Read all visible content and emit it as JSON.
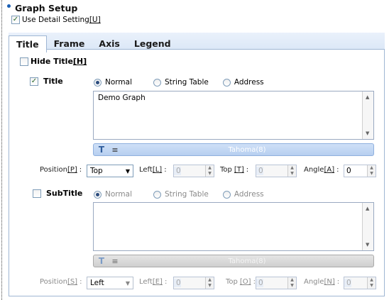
{
  "section": {
    "title": "Graph Setup"
  },
  "detail": {
    "label": "Use Detail Setting",
    "hotkey": "[U]",
    "checked": true
  },
  "tabs": [
    "Title",
    "Frame",
    "Axis",
    "Legend"
  ],
  "hide_title": {
    "label": "Hide Title",
    "hotkey": "[H]",
    "checked": false
  },
  "title": {
    "label": "Title",
    "checked": true,
    "radios": [
      "Normal",
      "String Table",
      "Address"
    ],
    "selected": "Normal",
    "text": "Demo Graph",
    "font": "Tahoma(8)",
    "position_label": "Position",
    "position_hotkey": "[P]",
    "position_value": "Top",
    "left_label": "Left",
    "left_hotkey": "[L]",
    "left_value": "0",
    "top_label": "Top",
    "top_hotkey": "[T]",
    "top_value": "0",
    "angle_label": "Angle",
    "angle_hotkey": "[A]",
    "angle_value": "0"
  },
  "subtitle": {
    "label": "SubTitle",
    "checked": false,
    "radios": [
      "Normal",
      "String Table",
      "Address"
    ],
    "selected": "Normal",
    "text": "",
    "font": "Tahoma(8)",
    "position_label": "Position",
    "position_hotkey": "[S]",
    "position_value": "Left",
    "left_label": "Left",
    "left_hotkey": "[E]",
    "left_value": "0",
    "top_label": "Top",
    "top_hotkey": "[O]",
    "top_value": "0",
    "angle_label": "Angle",
    "angle_hotkey": "[N]",
    "angle_value": "0"
  },
  "colon": ":"
}
